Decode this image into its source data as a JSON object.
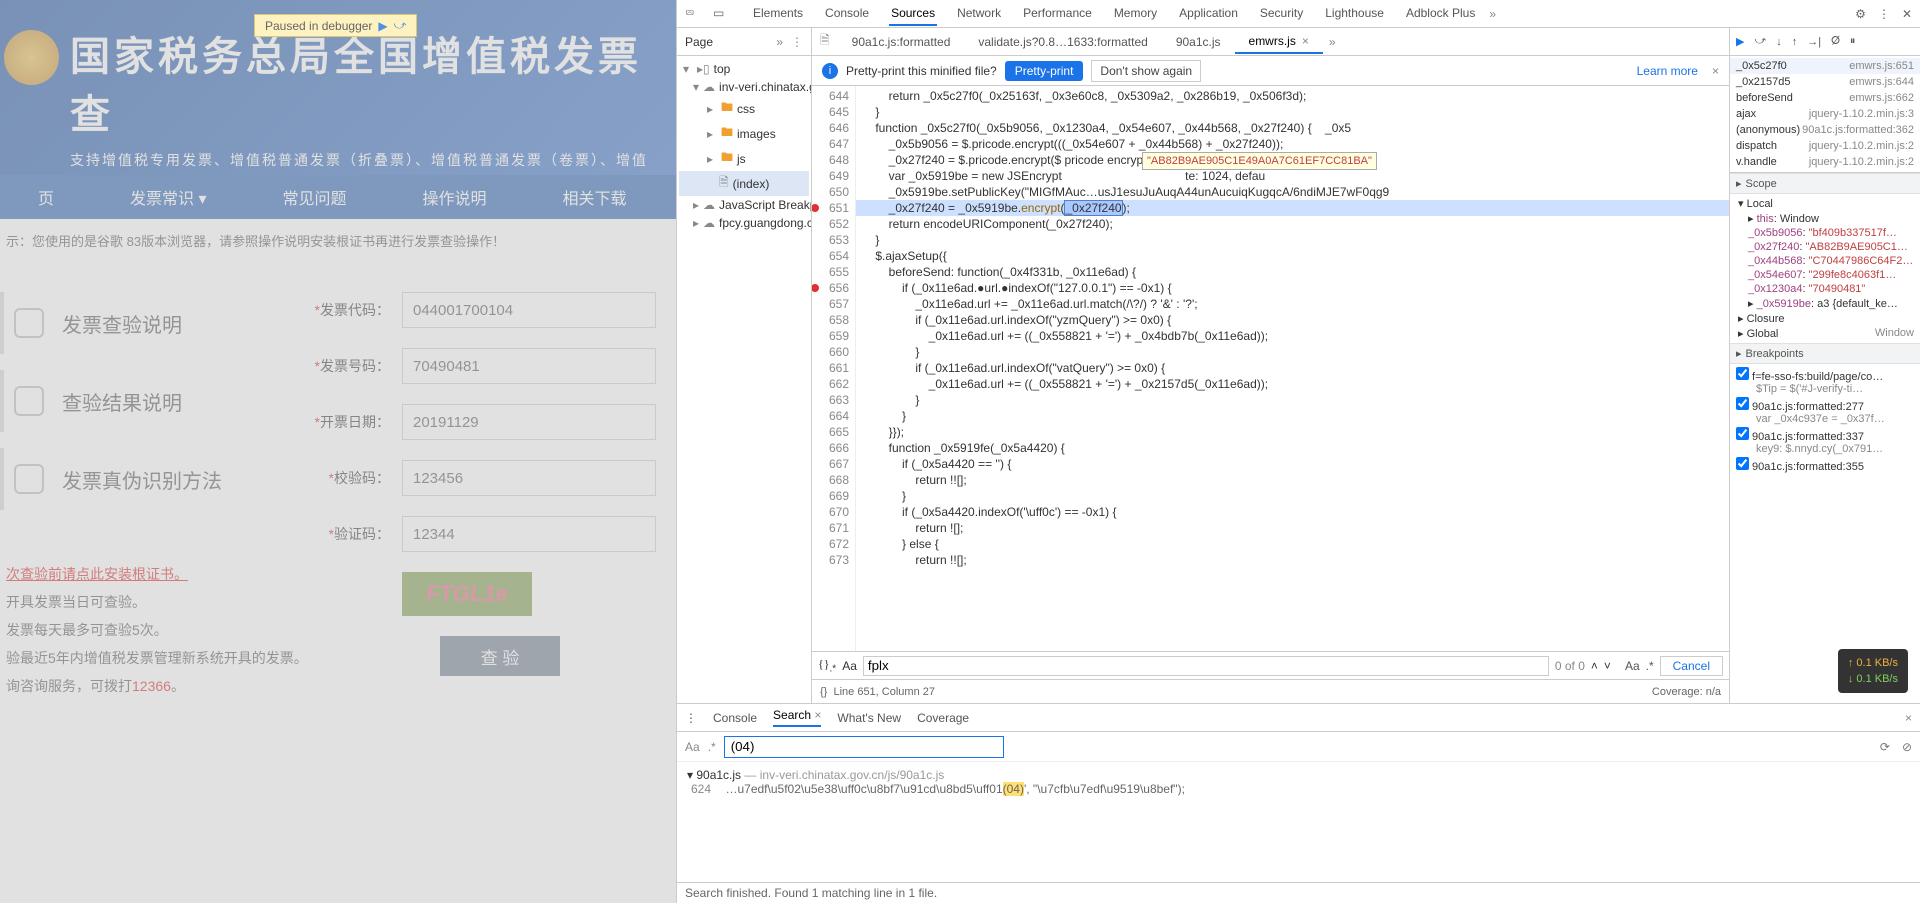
{
  "debugger_badge": "Paused in debugger",
  "hero": {
    "title": "国家税务总局全国增值税发票查",
    "subtitle": "支持增值税专用发票、增值税普通发票（折叠票）、增值税普通发票（卷票）、增值"
  },
  "nav": [
    "页",
    "发票常识 ▾",
    "常见问题",
    "操作说明",
    "相关下载"
  ],
  "warning": "示：您使用的是谷歌 83版本浏览器，请参照操作说明安装根证书再进行发票查验操作！",
  "side_items": [
    "发票查验说明",
    "查验结果说明",
    "发票真伪识别方法"
  ],
  "form": {
    "fpdm": {
      "label": "发票代码：",
      "value": "044001700104"
    },
    "fphm": {
      "label": "发票号码：",
      "value": "70490481"
    },
    "kprq": {
      "label": "开票日期：",
      "value": "20191129"
    },
    "jym": {
      "label": "校验码：",
      "value": "123456"
    },
    "yzm": {
      "label": "验证码：",
      "value": "12344"
    },
    "captcha": "FTGL1e",
    "submit": "查 验"
  },
  "notes": {
    "l1": "次查验前请点此安装根证书。",
    "l2": "开具发票当日可查验。",
    "l3": "发票每天最多可查验5次。",
    "l4": "验最近5年内增值税发票管理新系统开具的发票。",
    "l5_a": "询咨询服务，可拨打",
    "l5_b": "12366",
    "l5_c": "。"
  },
  "devtabs": [
    "Elements",
    "Console",
    "Sources",
    "Network",
    "Performance",
    "Memory",
    "Application",
    "Security",
    "Lighthouse",
    "Adblock Plus"
  ],
  "page_label": "Page",
  "tree": {
    "top": "top",
    "domain": "inv-veri.chinatax.g",
    "css": "css",
    "images": "images",
    "js": "js",
    "index": "(index)",
    "jsbp": "JavaScript Breakpo",
    "fpcy": "fpcy.guangdong.c"
  },
  "file_tabs": [
    {
      "label": "90a1c.js:formatted"
    },
    {
      "label": "validate.js?0.8…1633:formatted"
    },
    {
      "label": "90a1c.js"
    },
    {
      "label": "emwrs.js",
      "active": true
    }
  ],
  "pretty": {
    "msg": "Pretty-print this minified file?",
    "btn": "Pretty-print",
    "dont": "Don't show again",
    "learn": "Learn more"
  },
  "code_tooltip": "\"AB82B9AE905C1E49A0A7C61EF7CC81BA\"",
  "code": {
    "start": 644,
    "lines": [
      "        return _0x5c27f0(_0x25163f, _0x3e60c8, _0x5309a2, _0x286b19, _0x506f3d);",
      "    }",
      "    function _0x5c27f0(_0x5b9056, _0x1230a4, _0x54e607, _0x44b568, _0x27f240) {    _0x5",
      "        _0x5b9056 = $.pricode.encrypt(((_0x54e607 + _0x44b568) + _0x27f240));",
      "        _0x27f240 = $.pricode.encrypt($ pricode encrypt($ ccacode moveTo($.pricode.xx(",
      "        var _0x5919be = new JSEncrypt                                     te: 1024, defau",
      "        _0x5919be.setPublicKey(\"MIGfMAuc…usJ1esuJuAuqA44unAucuiqKugqcA/6ndiMJE7wF0qg9",
      "        _0x27f240 = _0x5919be.encrypt(_0x27f240);",
      "        return encodeURIComponent(_0x27f240);",
      "    }",
      "    $.ajaxSetup({",
      "        beforeSend: function(_0x4f331b, _0x11e6ad) {",
      "            if (_0x11e6ad.●url.●indexOf(\"127.0.0.1\") == -0x1) {",
      "                _0x11e6ad.url += _0x11e6ad.url.match(/\\?/) ? '&' : '?';",
      "                if (_0x11e6ad.url.indexOf(\"yzmQuery\") >= 0x0) {",
      "                    _0x11e6ad.url += ((_0x558821 + '=') + _0x4bdb7b(_0x11e6ad));",
      "                }",
      "                if (_0x11e6ad.url.indexOf(\"vatQuery\") >= 0x0) {",
      "                    _0x11e6ad.url += ((_0x558821 + '=') + _0x2157d5(_0x11e6ad));",
      "                }",
      "            }",
      "        }});",
      "        function _0x5919fe(_0x5a4420) {",
      "            if (_0x5a4420 == '') {",
      "                return !![];",
      "            }",
      "            if (_0x5a4420.indexOf('\\uff0c') == -0x1) {",
      "                return ![];",
      "            } else {",
      "                return !![];"
    ],
    "breakpoints": [
      651,
      656
    ]
  },
  "find": {
    "value": "fplx",
    "count": "0 of 0",
    "cancel": "Cancel"
  },
  "status": {
    "pos": "Line 651, Column 27",
    "cov": "Coverage: n/a"
  },
  "callstack": [
    {
      "fn": "_0x5c27f0",
      "loc": "emwrs.js:651",
      "sel": true
    },
    {
      "fn": "_0x2157d5",
      "loc": "emwrs.js:644"
    },
    {
      "fn": "beforeSend",
      "loc": "emwrs.js:662"
    },
    {
      "fn": "ajax",
      "loc": "jquery-1.10.2.min.js:3"
    },
    {
      "fn": "(anonymous)",
      "loc": "90a1c.js:formatted:362"
    },
    {
      "fn": "dispatch",
      "loc": "jquery-1.10.2.min.js:2"
    },
    {
      "fn": "v.handle",
      "loc": "jquery-1.10.2.min.js:2"
    }
  ],
  "scope_head": "Scope",
  "scope": {
    "local": "Local",
    "this": "this: Window",
    "v": [
      {
        "k": "_0x5b9056",
        "v": "\"bf409b337517f…"
      },
      {
        "k": "_0x27f240",
        "v": "\"AB82B9AE905C1…"
      },
      {
        "k": "_0x44b568",
        "v": "\"C70447986C64F2…"
      },
      {
        "k": "_0x54e607",
        "v": "\"299fe8c4063f1…"
      },
      {
        "k": "_0x1230a4",
        "v": "\"70490481\""
      },
      {
        "k": "_0x5919be",
        "v": "a3 {default_ke…",
        "obj": true
      }
    ],
    "closure": "Closure",
    "global": "Global",
    "window": "Window"
  },
  "bp_head": "Breakpoints",
  "bps": [
    {
      "l": "f=fe-sso-fs:build/page/co…",
      "s": "$Tip = $('#J-verify-ti…"
    },
    {
      "l": "90a1c.js:formatted:277",
      "s": "var _0x4c937e = _0x37f…"
    },
    {
      "l": "90a1c.js:formatted:337",
      "s": "key9: $.nnyd.cy(_0x791…"
    },
    {
      "l": "90a1c.js:formatted:355",
      "s": ""
    }
  ],
  "bottom_tabs": [
    "Console",
    "Search",
    "What's New",
    "Coverage"
  ],
  "search": {
    "value": "(04)",
    "aa": "Aa",
    "re": ".*"
  },
  "result": {
    "file": "90a1c.js",
    "path": " — inv-veri.chinatax.gov.cn/js/90a1c.js",
    "num": "624",
    "pre": "…u7edf\\u5f02\\u5e38\\uff0c\\u8bf7\\u91cd\\u8bd5\\uff01",
    "match": "(04)",
    "post": "', \"\\u7cfb\\u7edf\\u9519\\u8bef\");"
  },
  "search_status": "Search finished. Found 1 matching line in 1 file.",
  "net": {
    "up": "↑ 0.1 KB/s",
    "dn": "↓ 0.1 KB/s"
  }
}
